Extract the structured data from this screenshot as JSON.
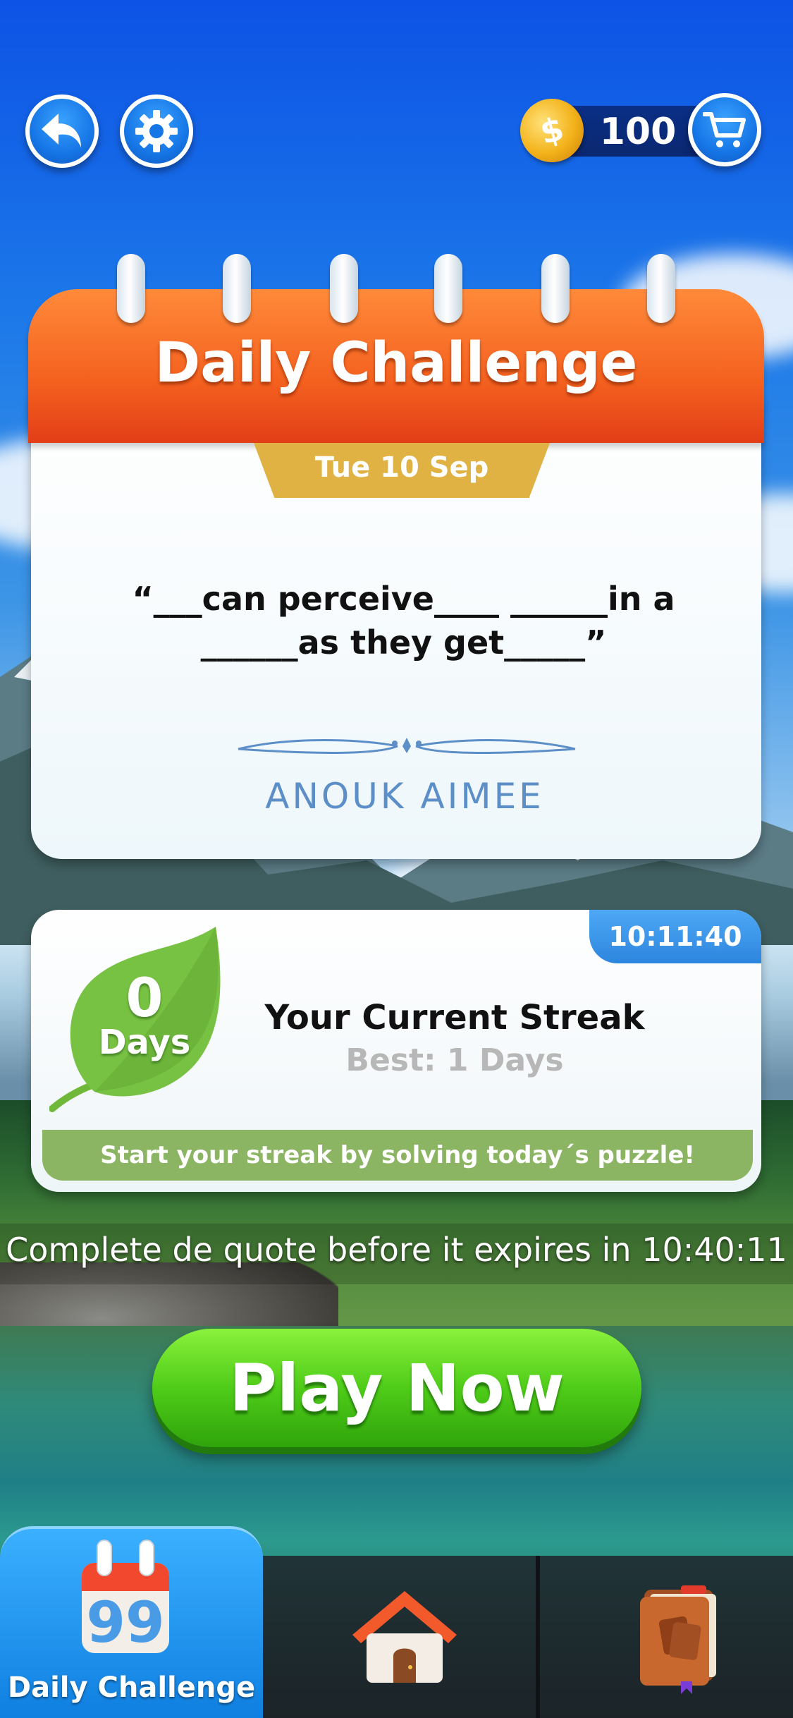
{
  "header": {
    "coins": "100",
    "icons": [
      "back-arrow-icon",
      "gear-icon",
      "coin-icon",
      "cart-icon"
    ]
  },
  "calendar": {
    "title": "Daily Challenge",
    "date": "Tue 10 Sep",
    "quote_line1": "“___can perceive____ ______in a",
    "quote_line2": "______as they get_____”",
    "author": "ANOUK AIMEE"
  },
  "streak": {
    "timer": "10:11:40",
    "count": "0",
    "unit": "Days",
    "title": "Your Current Streak",
    "best": "Best: 1 Days",
    "hint": "Start your streak by solving today´s puzzle!"
  },
  "expiry_text": "Complete de quote before it expires in 10:40:11",
  "play_button": "Play Now",
  "nav": {
    "active_label": "Daily Challenge",
    "items": [
      "calendar-quote-icon",
      "home-icon",
      "book-icon"
    ]
  },
  "colors": {
    "header_orange": "#f4611f",
    "play_green": "#4fcc19",
    "streak_green": "#8bb463",
    "nav_active_blue": "#1f8ff0"
  }
}
